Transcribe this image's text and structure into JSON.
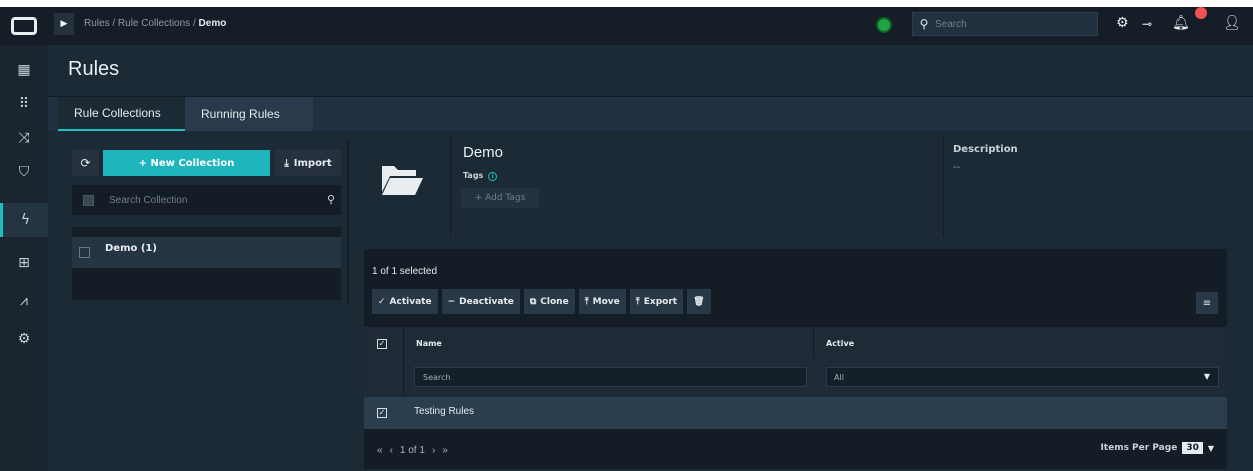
{
  "app": {
    "breadcrumb": {
      "part1": "Rules",
      "sep1": "/",
      "part2": "Rule Collections",
      "sep2": "/",
      "current": "Demo"
    },
    "search_placeholder": "Search"
  },
  "rail": {
    "items": [
      "dashboard",
      "modules",
      "rules",
      "shield",
      "lightning",
      "briefcase",
      "chart",
      "settings-dial"
    ]
  },
  "page": {
    "title": "Rules"
  },
  "tabs": [
    {
      "label": "Rule Collections"
    },
    {
      "label": "Running Rules"
    }
  ],
  "collections": {
    "new_label": "+ New Collection",
    "import_label": "Import",
    "search_placeholder": "Search Collection",
    "items": [
      {
        "label": "Demo (1)"
      }
    ]
  },
  "detail": {
    "title": "Demo",
    "tags_label": "Tags",
    "add_tags": "+ Add Tags",
    "description_label": "Description",
    "description_value": "--"
  },
  "rules_table": {
    "selection": "1 of 1 selected",
    "actions": {
      "activate": "Activate",
      "deactivate": "Deactivate",
      "clone": "Clone",
      "move": "Move",
      "export": "Export"
    },
    "columns": {
      "name": "Name",
      "active": "Active"
    },
    "filters": {
      "name_placeholder": "Search",
      "active_value": "All"
    },
    "rows": [
      {
        "name": "Testing Rules"
      }
    ],
    "pager": {
      "first": "«",
      "prev": "‹",
      "text": "1 of 1",
      "next": "›",
      "last": "»"
    },
    "items_per_page_label": "Items Per Page",
    "items_per_page_value": "30"
  },
  "colors": {
    "accent": "#1dbfbf",
    "status_ok": "#1ea446",
    "badge": "#ef5350"
  }
}
